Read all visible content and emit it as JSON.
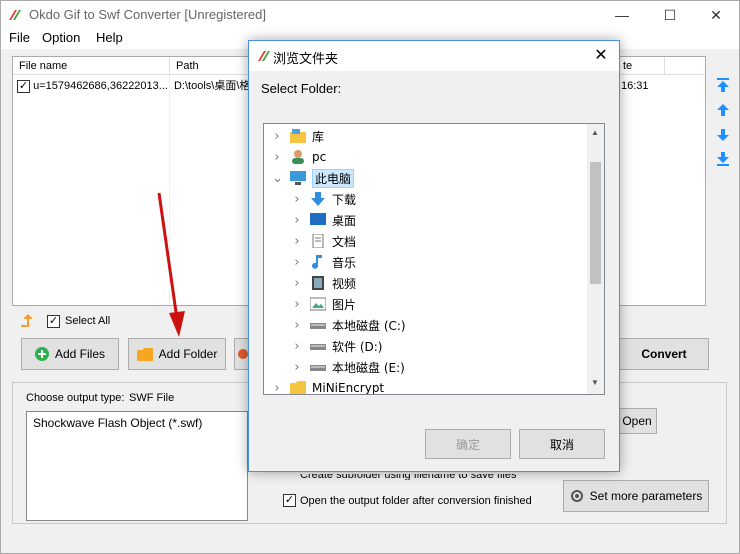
{
  "window": {
    "title": "Okdo Gif to Swf Converter [Unregistered]",
    "min_glyph": "—",
    "max_glyph": "☐",
    "close_glyph": "✕"
  },
  "menu": [
    "File",
    "Option",
    "Help"
  ],
  "filelist": {
    "columns": [
      "File name",
      "Path",
      "te"
    ],
    "rows": [
      {
        "checked": true,
        "name": "u=1579462686,36222013...",
        "path": "D:\\tools\\桌面\\格",
        "time": "16:31"
      }
    ]
  },
  "select_all_label": "Select All",
  "buttons": {
    "add_files": "Add Files",
    "add_folder": "Add Folder",
    "convert": "Convert",
    "open": "Open",
    "set_more_parameters": "Set more parameters"
  },
  "output": {
    "choose_type_label": "Choose output type:",
    "type_value": "SWF File",
    "list_item": "Shockwave Flash Object (*.swf)",
    "subfolder_option": "Create subfolder using filename to save files",
    "open_folder_option": "Open the output folder after conversion finished",
    "open_folder_checked": true
  },
  "dialog": {
    "title": "浏览文件夹",
    "prompt": "Select Folder:",
    "tree": [
      {
        "label": "库",
        "level": 0,
        "expanded": false,
        "icon": "library-icon"
      },
      {
        "label": "pc",
        "level": 0,
        "expanded": false,
        "icon": "user-icon"
      },
      {
        "label": "此电脑",
        "level": 0,
        "expanded": true,
        "selected": true,
        "icon": "computer-icon"
      },
      {
        "label": "下载",
        "level": 1,
        "icon": "download-icon"
      },
      {
        "label": "桌面",
        "level": 1,
        "icon": "desktop-icon"
      },
      {
        "label": "文档",
        "level": 1,
        "icon": "document-icon"
      },
      {
        "label": "音乐",
        "level": 1,
        "icon": "music-icon"
      },
      {
        "label": "视频",
        "level": 1,
        "icon": "video-icon"
      },
      {
        "label": "图片",
        "level": 1,
        "icon": "picture-icon"
      },
      {
        "label": "本地磁盘 (C:)",
        "level": 1,
        "icon": "drive-icon"
      },
      {
        "label": "软件 (D:)",
        "level": 1,
        "icon": "drive-icon"
      },
      {
        "label": "本地磁盘 (E:)",
        "level": 1,
        "icon": "drive-icon"
      },
      {
        "label": "MiNiEncrypt",
        "level": 0,
        "icon": "folder-icon"
      }
    ],
    "ok_label": "确定",
    "cancel_label": "取消",
    "close_glyph": "✕"
  },
  "colors": {
    "accent_blue": "#1e90ff",
    "selection": "#cce8ff",
    "arrow_red": "#cc1111"
  }
}
